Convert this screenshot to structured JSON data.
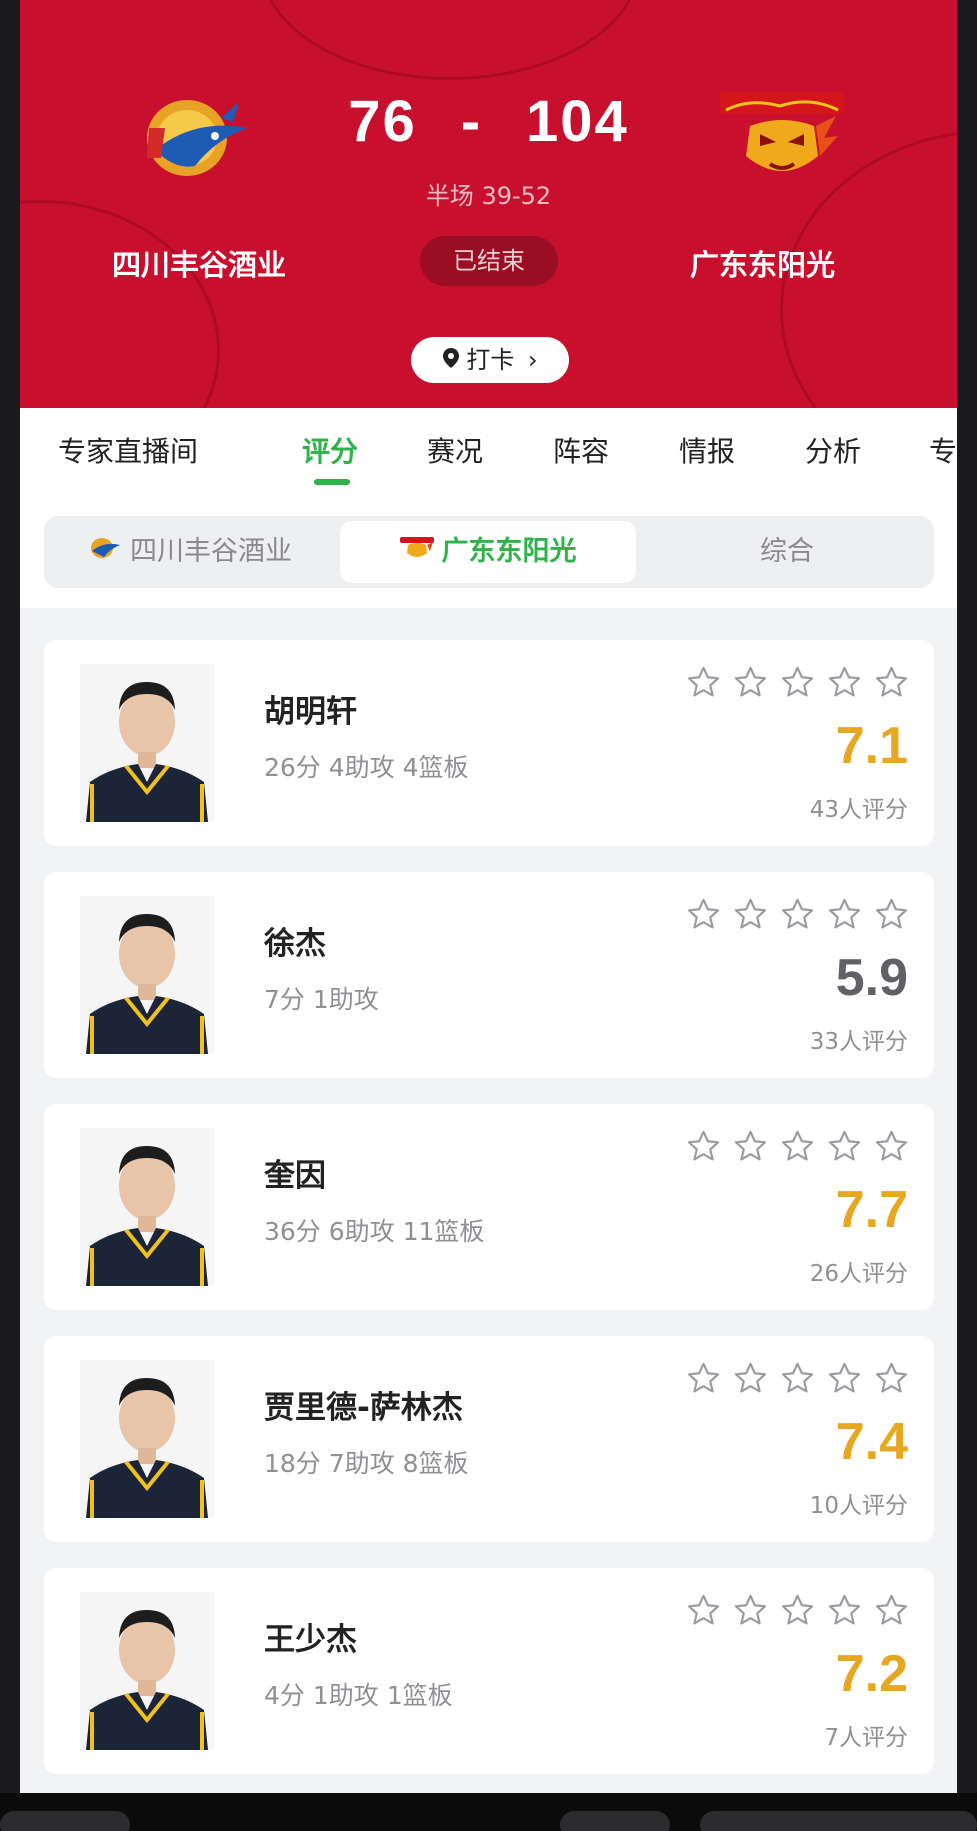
{
  "match": {
    "home_team": "四川丰谷酒业",
    "away_team": "广东东阳光",
    "home_score": "76",
    "score_sep": "-",
    "away_score": "104",
    "half_score": "半场 39-52",
    "status": "已结束",
    "checkin_label": "打卡"
  },
  "colors": {
    "brand_red": "#c8102e",
    "accent_green": "#2eb34a",
    "rating_gold": "#e8a720",
    "rating_gray": "#5f6166"
  },
  "tabs": [
    {
      "label": "专家直播间"
    },
    {
      "label": "评分",
      "active": true
    },
    {
      "label": "赛况"
    },
    {
      "label": "阵容"
    },
    {
      "label": "情报"
    },
    {
      "label": "分析"
    },
    {
      "label": "专"
    }
  ],
  "segments": [
    {
      "label": "四川丰谷酒业",
      "icon": "sichuan-logo-icon"
    },
    {
      "label": "广东东阳光",
      "icon": "guangdong-logo-icon",
      "active": true
    },
    {
      "label": "综合"
    }
  ],
  "players": [
    {
      "name": "胡明轩",
      "stats": "26分 4助攻 4篮板",
      "rating": "7.1",
      "votes": "43人评分",
      "highlight": true
    },
    {
      "name": "徐杰",
      "stats": "7分 1助攻",
      "rating": "5.9",
      "votes": "33人评分",
      "highlight": false
    },
    {
      "name": "奎因",
      "stats": "36分 6助攻 11篮板",
      "rating": "7.7",
      "votes": "26人评分",
      "highlight": true
    },
    {
      "name": "贾里德-萨林杰",
      "stats": "18分 7助攻 8篮板",
      "rating": "7.4",
      "votes": "10人评分",
      "highlight": true
    },
    {
      "name": "王少杰",
      "stats": "4分 1助攻 1篮板",
      "rating": "7.2",
      "votes": "7人评分",
      "highlight": true
    }
  ]
}
